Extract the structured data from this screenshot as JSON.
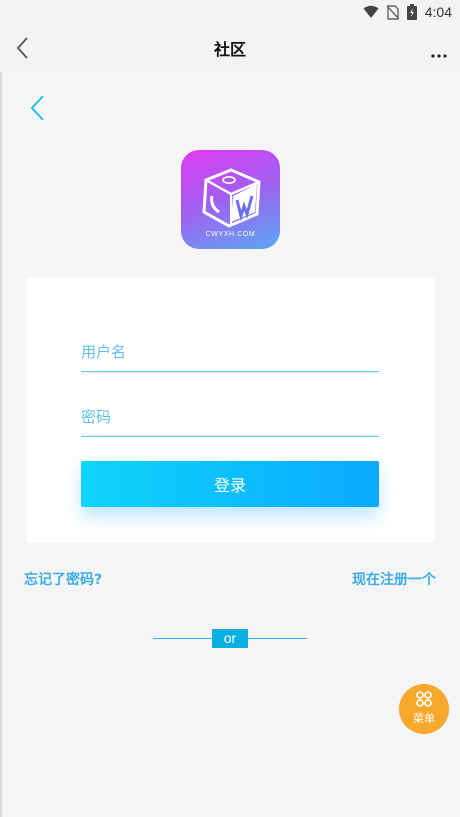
{
  "status_bar": {
    "time": "4:04"
  },
  "app_bar": {
    "title": "社区",
    "more_label": "..."
  },
  "logo": {
    "text": "CWYXH.COM",
    "letter": "W"
  },
  "login_form": {
    "username_placeholder": "用户名",
    "password_placeholder": "密码",
    "submit_label": "登录"
  },
  "links": {
    "forgot_password": "忘记了密码?",
    "register": "现在注册一个"
  },
  "divider": {
    "text": "or"
  },
  "fab": {
    "label": "菜单"
  },
  "colors": {
    "accent": "#0aa9ff",
    "link": "#3dade3",
    "fab": "#f6a82d",
    "logo_gradient_start": "#e03bf2",
    "logo_gradient_end": "#5aa8f4"
  }
}
